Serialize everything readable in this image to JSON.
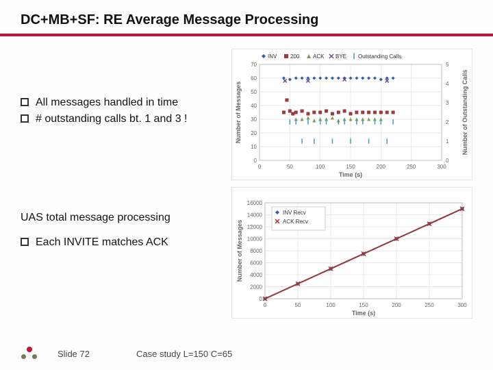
{
  "title": "DC+MB+SF: RE Average Message Processing",
  "bullets_top": [
    "All messages handled in time",
    "# outstanding calls bt. 1 and 3 !"
  ],
  "section2_label": "UAS total message processing",
  "bullets_bottom": [
    "Each INVITE matches ACK"
  ],
  "footer": {
    "slide": "Slide 72",
    "case": "Case study L=150 C=65"
  },
  "chart_data": [
    {
      "type": "scatter",
      "title": "",
      "xlabel": "Time (s)",
      "ylabel_left": "Number of Messages",
      "ylabel_right": "Number of Outstanding Calls",
      "xlim": [
        0,
        300
      ],
      "ylim_left": [
        0,
        70
      ],
      "ylim_right": [
        0,
        5
      ],
      "x_ticks": [
        0,
        50,
        100,
        150,
        200,
        250,
        300
      ],
      "y_ticks_left": [
        0,
        10,
        20,
        30,
        40,
        50,
        60,
        70
      ],
      "y_ticks_right": [
        0,
        1,
        2,
        3,
        4,
        5
      ],
      "series": [
        {
          "name": "INV",
          "marker": "diamond",
          "color": "#2f5fa3",
          "axis": "left",
          "points": [
            {
              "x": 40,
              "y": 60
            },
            {
              "x": 50,
              "y": 59
            },
            {
              "x": 60,
              "y": 60
            },
            {
              "x": 70,
              "y": 60
            },
            {
              "x": 80,
              "y": 60
            },
            {
              "x": 90,
              "y": 60
            },
            {
              "x": 100,
              "y": 60
            },
            {
              "x": 110,
              "y": 60
            },
            {
              "x": 120,
              "y": 60
            },
            {
              "x": 130,
              "y": 60
            },
            {
              "x": 140,
              "y": 60
            },
            {
              "x": 150,
              "y": 60
            },
            {
              "x": 160,
              "y": 60
            },
            {
              "x": 170,
              "y": 60
            },
            {
              "x": 180,
              "y": 60
            },
            {
              "x": 190,
              "y": 60
            },
            {
              "x": 200,
              "y": 59
            },
            {
              "x": 210,
              "y": 60
            },
            {
              "x": 220,
              "y": 60
            }
          ]
        },
        {
          "name": "200",
          "marker": "square",
          "color": "#9b3b3b",
          "axis": "left",
          "points": [
            {
              "x": 40,
              "y": 35
            },
            {
              "x": 45,
              "y": 44
            },
            {
              "x": 50,
              "y": 36
            },
            {
              "x": 55,
              "y": 34
            },
            {
              "x": 60,
              "y": 35
            },
            {
              "x": 70,
              "y": 36
            },
            {
              "x": 80,
              "y": 34
            },
            {
              "x": 90,
              "y": 35
            },
            {
              "x": 100,
              "y": 35
            },
            {
              "x": 110,
              "y": 36
            },
            {
              "x": 120,
              "y": 34
            },
            {
              "x": 130,
              "y": 35
            },
            {
              "x": 140,
              "y": 36
            },
            {
              "x": 150,
              "y": 34
            },
            {
              "x": 160,
              "y": 35
            },
            {
              "x": 170,
              "y": 35
            },
            {
              "x": 180,
              "y": 35
            },
            {
              "x": 190,
              "y": 35
            },
            {
              "x": 200,
              "y": 35
            },
            {
              "x": 210,
              "y": 35
            },
            {
              "x": 220,
              "y": 35
            }
          ]
        },
        {
          "name": "ACK",
          "marker": "triangle",
          "color": "#7a9a4e",
          "axis": "left",
          "points": [
            {
              "x": 60,
              "y": 30
            },
            {
              "x": 70,
              "y": 30
            },
            {
              "x": 80,
              "y": 31
            },
            {
              "x": 90,
              "y": 29
            },
            {
              "x": 100,
              "y": 30
            },
            {
              "x": 110,
              "y": 30
            },
            {
              "x": 120,
              "y": 31
            },
            {
              "x": 130,
              "y": 29
            },
            {
              "x": 140,
              "y": 30
            },
            {
              "x": 150,
              "y": 30
            },
            {
              "x": 160,
              "y": 30
            },
            {
              "x": 170,
              "y": 30
            },
            {
              "x": 180,
              "y": 30
            },
            {
              "x": 190,
              "y": 30
            },
            {
              "x": 200,
              "y": 30
            }
          ]
        },
        {
          "name": "BYE",
          "marker": "x",
          "color": "#6a4a8a",
          "axis": "left",
          "points": [
            {
              "x": 42,
              "y": 58
            },
            {
              "x": 80,
              "y": 58
            },
            {
              "x": 140,
              "y": 59
            },
            {
              "x": 210,
              "y": 58
            }
          ]
        },
        {
          "name": "Outstanding Calls",
          "marker": "bar",
          "color": "#3ca0b8",
          "axis": "right",
          "points": [
            {
              "x": 50,
              "y": 2
            },
            {
              "x": 60,
              "y": 2
            },
            {
              "x": 70,
              "y": 1
            },
            {
              "x": 80,
              "y": 2
            },
            {
              "x": 90,
              "y": 1
            },
            {
              "x": 100,
              "y": 2
            },
            {
              "x": 110,
              "y": 2
            },
            {
              "x": 120,
              "y": 1
            },
            {
              "x": 130,
              "y": 2
            },
            {
              "x": 140,
              "y": 2
            },
            {
              "x": 150,
              "y": 1
            },
            {
              "x": 160,
              "y": 2
            },
            {
              "x": 170,
              "y": 2
            },
            {
              "x": 180,
              "y": 1
            },
            {
              "x": 190,
              "y": 2
            },
            {
              "x": 200,
              "y": 2
            },
            {
              "x": 210,
              "y": 1
            },
            {
              "x": 220,
              "y": 2
            }
          ]
        }
      ]
    },
    {
      "type": "line",
      "title": "",
      "xlabel": "Time (s)",
      "ylabel_left": "Number of Messages",
      "xlim": [
        0,
        300
      ],
      "ylim_left": [
        0,
        16000
      ],
      "x_ticks": [
        0,
        50,
        100,
        150,
        200,
        250,
        300
      ],
      "y_ticks_left": [
        0,
        2000,
        4000,
        6000,
        8000,
        10000,
        12000,
        14000,
        16000
      ],
      "series": [
        {
          "name": "INV Recv",
          "marker": "diamond",
          "color": "#2f5fa3",
          "axis": "left",
          "points": [
            {
              "x": 0,
              "y": 0
            },
            {
              "x": 50,
              "y": 2500
            },
            {
              "x": 100,
              "y": 5000
            },
            {
              "x": 150,
              "y": 7500
            },
            {
              "x": 200,
              "y": 10000
            },
            {
              "x": 250,
              "y": 12500
            },
            {
              "x": 300,
              "y": 15000
            }
          ]
        },
        {
          "name": "ACK Recv",
          "marker": "x",
          "color": "#9b3b3b",
          "axis": "left",
          "points": [
            {
              "x": 0,
              "y": 0
            },
            {
              "x": 50,
              "y": 2500
            },
            {
              "x": 100,
              "y": 5000
            },
            {
              "x": 150,
              "y": 7500
            },
            {
              "x": 200,
              "y": 10000
            },
            {
              "x": 250,
              "y": 12500
            },
            {
              "x": 300,
              "y": 15000
            }
          ]
        }
      ]
    }
  ]
}
